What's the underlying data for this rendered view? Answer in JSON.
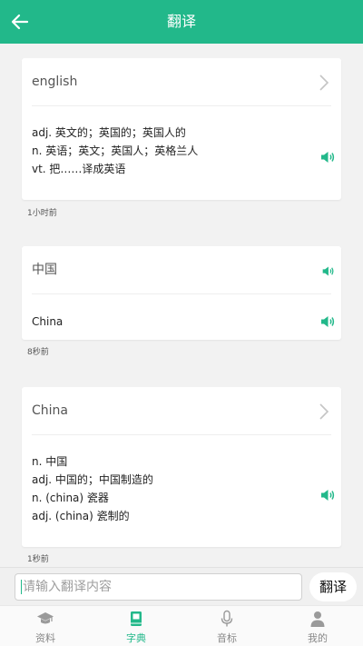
{
  "header": {
    "title": "翻译",
    "back_icon": "arrow-left-icon"
  },
  "colors": {
    "accent": "#22b88a",
    "background": "#f2f2f2"
  },
  "history": [
    {
      "source": "english",
      "meanings": [
        "adj. 英文的；英国的；英国人的",
        "n. 英语；英文；英国人；英格兰人",
        "vt. 把……译成英语"
      ],
      "time": "1小时前"
    },
    {
      "source": "中国",
      "meanings": [
        "China"
      ],
      "time": "8秒前"
    },
    {
      "source": "China",
      "meanings": [
        "n. 中国",
        "adj. 中国的；中国制造的",
        "n. (china) 瓷器",
        "adj. (china) 瓷制的"
      ],
      "time": "1秒前"
    }
  ],
  "input": {
    "placeholder": "请输入翻译内容",
    "button_label": "翻译"
  },
  "tabs": [
    {
      "label": "资料",
      "icon": "graduation-cap-icon",
      "active": false
    },
    {
      "label": "字典",
      "icon": "book-icon",
      "active": true
    },
    {
      "label": "音标",
      "icon": "microphone-icon",
      "active": false
    },
    {
      "label": "我的",
      "icon": "person-icon",
      "active": false
    }
  ]
}
